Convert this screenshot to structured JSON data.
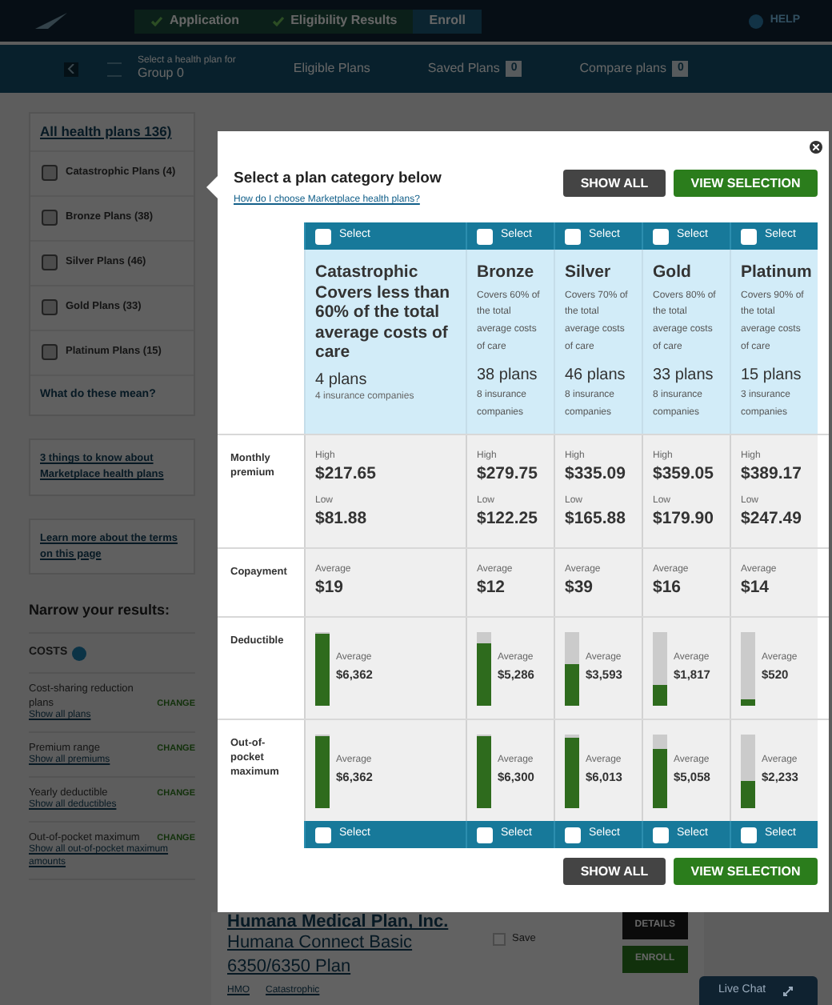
{
  "top_nav": {
    "steps": [
      {
        "label": "Application",
        "done": true
      },
      {
        "label": "Eligibility Results",
        "done": true
      },
      {
        "label": "Enroll",
        "done": false
      }
    ],
    "help": "HELP"
  },
  "sub_nav": {
    "select_label": "Select a health plan for",
    "group": "Group 0",
    "tabs": [
      {
        "label": "Eligible Plans"
      },
      {
        "label": "Saved Plans",
        "count": "0"
      },
      {
        "label": "Compare plans",
        "count": "0"
      }
    ]
  },
  "sidebar": {
    "all_link": "All health plans 136)",
    "categories": [
      {
        "label": "Catastrophic Plans (4)",
        "checked": false
      },
      {
        "label": "Bronze Plans (38)",
        "checked": false
      },
      {
        "label": "Silver Plans (46)",
        "checked": false
      },
      {
        "label": "Gold Plans (33)",
        "checked": false
      },
      {
        "label": "Platinum Plans (15)",
        "checked": false
      }
    ],
    "what_link": "What do these mean?",
    "info_links": [
      "3 things to know about Marketplace health plans",
      "Learn more about the terms on this page"
    ],
    "narrow_title": "Narrow your results:",
    "costs_label": "COSTS",
    "filters": [
      {
        "label": "Cost-sharing reduction plans",
        "link": "Show all plans",
        "action": "CHANGE"
      },
      {
        "label": "Premium range",
        "link": "Show all premiums",
        "action": "CHANGE"
      },
      {
        "label": "Yearly deductible",
        "link": "Show all deductibles",
        "action": "CHANGE"
      },
      {
        "label": "Out-of-pocket maximum",
        "link": "Show all out-of-pocket maximum amounts",
        "action": "CHANGE"
      }
    ]
  },
  "plan": {
    "issuer": "Humana Medical Plan, Inc.",
    "name": "Humana Connect Basic 6350/6350 Plan",
    "tags": [
      "HMO",
      "Catastrophic"
    ],
    "save": "Save",
    "save_checked": false,
    "details": "DETAILS",
    "enroll": "ENROLL"
  },
  "live_chat": "Live Chat",
  "modal": {
    "title": "Select a plan category below",
    "help_link": "How do I choose Marketplace health plans?",
    "show_all": "SHOW ALL",
    "view_selection": "VIEW SELECTION",
    "bottom_show_all": "SHOW ALL",
    "bottom_view_selection": "VIEW SELECTION",
    "row_labels": {
      "premium": "Monthly premium",
      "copay": "Copayment",
      "deductible": "Deductible",
      "oop": "Out-of-pocket maximum"
    },
    "columns": [
      {
        "kind": "catastrophic",
        "select_top": "Select",
        "select_bottom": "Select",
        "selected": false,
        "name": "Catastrophic",
        "description": "Covers less than 60% of the total average costs of care",
        "plans": "4 plans",
        "companies": "4 insurance companies",
        "high_label": "High",
        "high": "$217.65",
        "low_label": "Low",
        "low": "$81.88",
        "copay_label": "Average",
        "copay": "$19",
        "deductible": {
          "label": "Average",
          "value": "$6,362",
          "level": 1
        },
        "oop": {
          "label": "Average",
          "value": "$6,362",
          "level": 1
        }
      },
      {
        "kind": "metal",
        "select_top": "Select",
        "select_bottom": "Select",
        "selected": false,
        "name": "Bronze",
        "description": "Covers 60% of the total average costs of care",
        "plans": "38 plans",
        "companies": "8 insurance companies",
        "high_label": "High",
        "high": "$279.75",
        "low_label": "Low",
        "low": "$122.25",
        "copay_label": "Average",
        "copay": "$12",
        "deductible": {
          "label": "Average",
          "value": "$5,286",
          "level": 0.85
        },
        "oop": {
          "label": "Average",
          "value": "$6,300",
          "level": 1
        }
      },
      {
        "kind": "metal",
        "select_top": "Select",
        "select_bottom": "Select",
        "selected": false,
        "name": "Silver",
        "description": "Covers 70% of the total average costs of care",
        "plans": "46 plans",
        "companies": "8 insurance companies",
        "high_label": "High",
        "high": "$335.09",
        "low_label": "Low",
        "low": "$165.88",
        "copay_label": "Average",
        "copay": "$39",
        "deductible": {
          "label": "Average",
          "value": "$3,593",
          "level": 0.57
        },
        "oop": {
          "label": "Average",
          "value": "$6,013",
          "level": 0.96
        }
      },
      {
        "kind": "metal",
        "select_top": "Select",
        "select_bottom": "Select",
        "selected": false,
        "name": "Gold",
        "description": "Covers 80% of the total average costs of care",
        "plans": "33 plans",
        "companies": "8 insurance companies",
        "high_label": "High",
        "high": "$359.05",
        "low_label": "Low",
        "low": "$179.90",
        "copay_label": "Average",
        "copay": "$16",
        "deductible": {
          "label": "Average",
          "value": "$1,817",
          "level": 0.28
        },
        "oop": {
          "label": "Average",
          "value": "$5,058",
          "level": 0.81
        }
      },
      {
        "kind": "metal",
        "select_top": "Select",
        "select_bottom": "Select",
        "selected": false,
        "name": "Platinum",
        "description": "Covers 90% of the total average costs of care",
        "plans": "15 plans",
        "companies": "3 insurance companies",
        "high_label": "High",
        "high": "$389.17",
        "low_label": "Low",
        "low": "$247.49",
        "copay_label": "Average",
        "copay": "$14",
        "deductible": {
          "label": "Average",
          "value": "$520",
          "level": 0.08
        },
        "oop": {
          "label": "Average",
          "value": "$2,233",
          "level": 0.36
        }
      }
    ]
  }
}
